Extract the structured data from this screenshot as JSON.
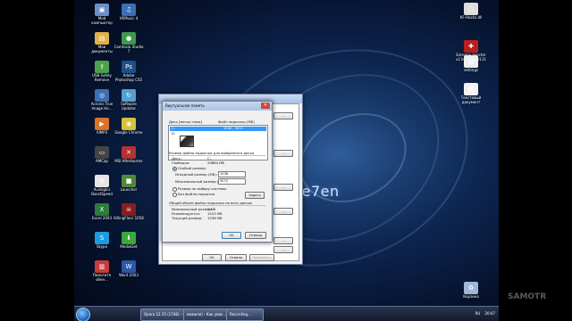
{
  "desktop": {
    "logo": "Se7en",
    "left_icons": [
      {
        "label": "Мой\nкомпьютер",
        "color": "#6b8fc7",
        "glyph": "▣"
      },
      {
        "label": "VKMusic 4",
        "color": "#3d6fb5",
        "glyph": "♫"
      },
      {
        "label": "Мои\nдокументы",
        "color": "#e0b14a",
        "glyph": "▤"
      },
      {
        "label": "Camtasia Studio\n7",
        "color": "#3e9a4a",
        "glyph": "●"
      },
      {
        "label": "USB Safely\nRemove",
        "color": "#4aa34a",
        "glyph": "⇪"
      },
      {
        "label": "Adobe\nPhotoshop CS5",
        "color": "#1f4f8a",
        "glyph": "Ps"
      },
      {
        "label": "Acronis True\nImage Ho...",
        "color": "#3a6fb0",
        "glyph": "◎"
      },
      {
        "label": "Software\nUpdater",
        "color": "#55a0d0",
        "glyph": "↻"
      },
      {
        "label": "AIMP3",
        "color": "#d9732b",
        "glyph": "▶"
      },
      {
        "label": "Google Chrome",
        "color": "#d8c13a",
        "glyph": "◉"
      },
      {
        "label": "AMCap",
        "color": "#444444",
        "glyph": "▭"
      },
      {
        "label": "MSI Afterburner",
        "color": "#b33232",
        "glyph": "✕"
      },
      {
        "label": "Auslogics\nBoostSpeed",
        "color": "#e6e6e6",
        "glyph": "⚙"
      },
      {
        "label": "Launcher",
        "color": "#4e8a3a",
        "glyph": "■"
      },
      {
        "label": "Excel 2003",
        "color": "#2d7d3a",
        "glyph": "X"
      },
      {
        "label": "KillingFloor 1058",
        "color": "#8a1d1d",
        "glyph": "☠"
      },
      {
        "label": "Skype",
        "color": "#1e9be0",
        "glyph": "S"
      },
      {
        "label": "MediaGet",
        "color": "#3aa83a",
        "glyph": "⬇"
      },
      {
        "label": "Помогите\nобен...",
        "color": "#c93a3a",
        "glyph": "▥"
      },
      {
        "label": "Word 2003",
        "color": "#2b58a8",
        "glyph": "W"
      }
    ],
    "right_icons": [
      {
        "label": "KF-Hacks.dll",
        "color": "#dddddd",
        "glyph": "▢"
      },
      {
        "label": "Extreme Injector\nv2 by master131",
        "color": "#b82020",
        "glyph": "✚"
      },
      {
        "label": "settings",
        "color": "#eeeeee",
        "glyph": "▤"
      },
      {
        "label": "Текстовый\nдокумент",
        "color": "#f2f2f2",
        "glyph": "▤"
      },
      {
        "label": "Корзина",
        "color": "#9fb7d8",
        "glyph": "♻"
      }
    ]
  },
  "taskbar": {
    "items": [
      "Opera 12.15 (1748) - Co...",
      "иммиля) - Как уввл...",
      "Recording..."
    ],
    "tray_lang": "RU",
    "tray_time": "20:07"
  },
  "dialog": {
    "title": "Виртуальная память",
    "col_drive": "Диск [метка тома]",
    "col_pagefile": "Файл подкачки (МБ)",
    "selected_drive": "C:",
    "selected_size": "1536 - 3072",
    "other_drive": "D:",
    "group_title": "Размер файла подкачки для выбранного диска",
    "disk_label": "Диск:",
    "disk_value": "C:",
    "free_label": "Свободно:",
    "free_value": "29884 МБ",
    "custom_size": "Особый размер:",
    "initial_label": "Исходный размер (МБ):",
    "initial_value": "1536",
    "max_label": "Максимальный размер (МБ):",
    "max_value": "3072",
    "system_size": "Размер по выбору системы",
    "no_pagefile": "Без файла подкачки",
    "set_button": "Задать",
    "total_title": "Общий объем файла подкачки на всех дисках",
    "min_label": "Минимальный размер:",
    "min_value": "2 МБ",
    "rec_label": "Рекомендуется:",
    "rec_value": "1523 МБ",
    "cur_label": "Текущий размер:",
    "cur_value": "1536 МБ",
    "ok": "OK",
    "cancel": "Отмена"
  },
  "behind_dialog": {
    "ok": "OK",
    "cancel": "Отмена",
    "apply": "Применить",
    "side_buttons": [
      "...",
      "...",
      "...",
      "...",
      "...",
      "..."
    ]
  },
  "watermark": "SAMOTR"
}
